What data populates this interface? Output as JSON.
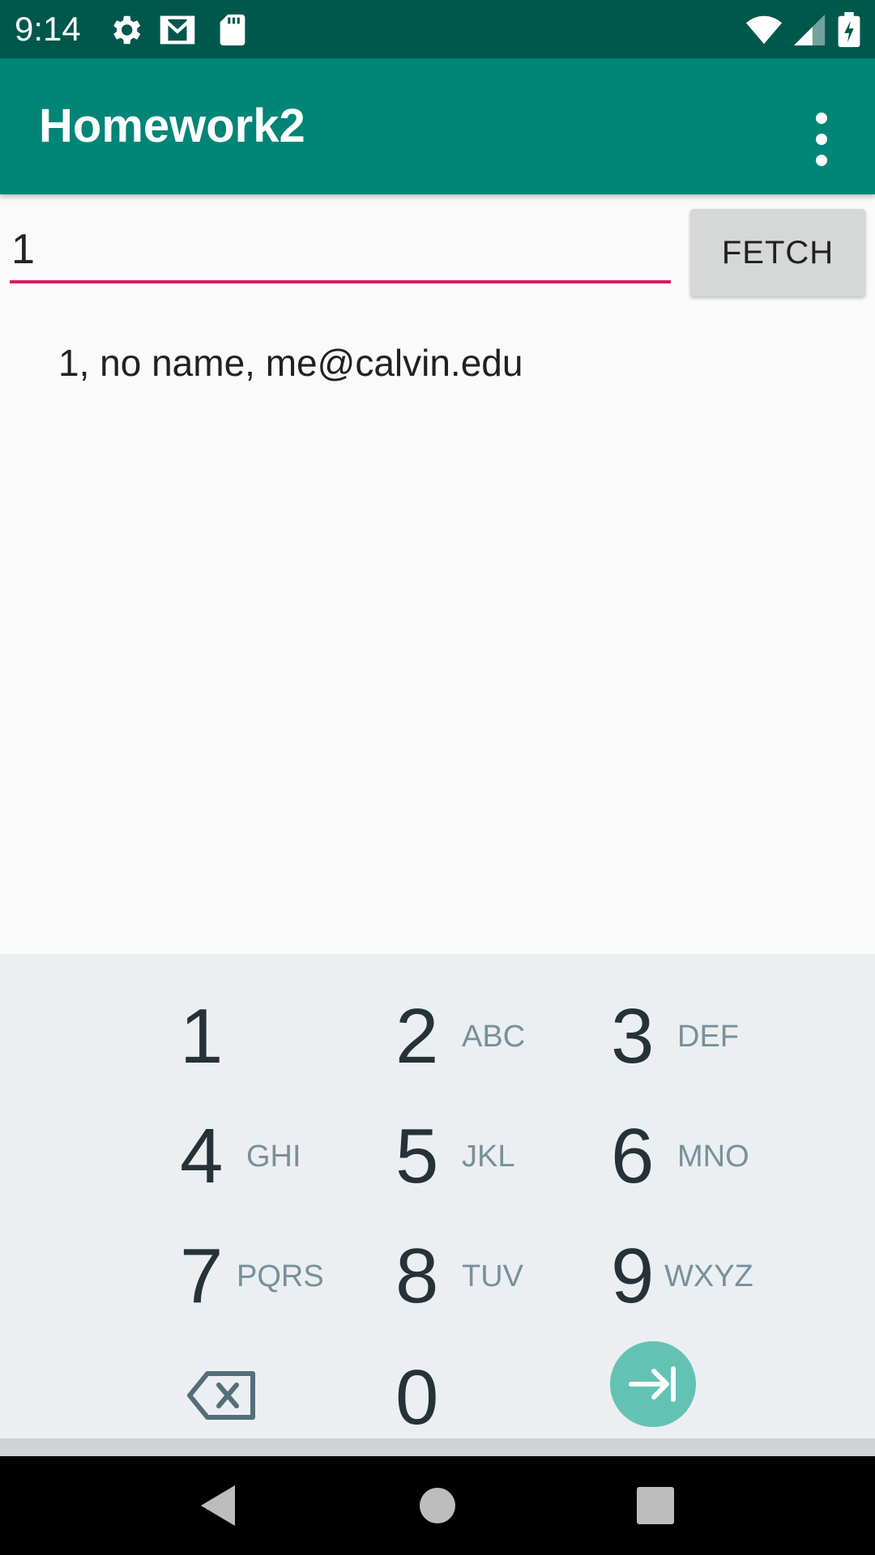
{
  "status_bar": {
    "time": "9:14",
    "icons": [
      "gear-icon",
      "gmail-icon",
      "sd-card-icon",
      "wifi-icon",
      "signal-icon",
      "battery-charging-icon"
    ]
  },
  "app_bar": {
    "title": "Homework2",
    "menu_icon": "overflow-menu-icon"
  },
  "form": {
    "input_value": "1",
    "fetch_label": "FETCH"
  },
  "result": {
    "text": "1, no name, me@calvin.edu"
  },
  "keypad": {
    "keys": [
      {
        "digit": "1",
        "letters": ""
      },
      {
        "digit": "2",
        "letters": "ABC"
      },
      {
        "digit": "3",
        "letters": "DEF"
      },
      {
        "digit": "4",
        "letters": "GHI"
      },
      {
        "digit": "5",
        "letters": "JKL"
      },
      {
        "digit": "6",
        "letters": "MNO"
      },
      {
        "digit": "7",
        "letters": "PQRS"
      },
      {
        "digit": "8",
        "letters": "TUV"
      },
      {
        "digit": "9",
        "letters": "WXYZ"
      },
      {
        "digit": "0",
        "letters": ""
      }
    ],
    "delete_icon": "backspace-icon",
    "enter_icon": "next-field-icon"
  },
  "nav_bar": {
    "icons": [
      "back-icon",
      "home-icon",
      "recents-icon"
    ]
  },
  "colors": {
    "status_bar": "#00574b",
    "app_bar": "#008577",
    "accent": "#d81b60",
    "keypad_bg": "#eceff1",
    "enter_key": "#64c2b5"
  }
}
